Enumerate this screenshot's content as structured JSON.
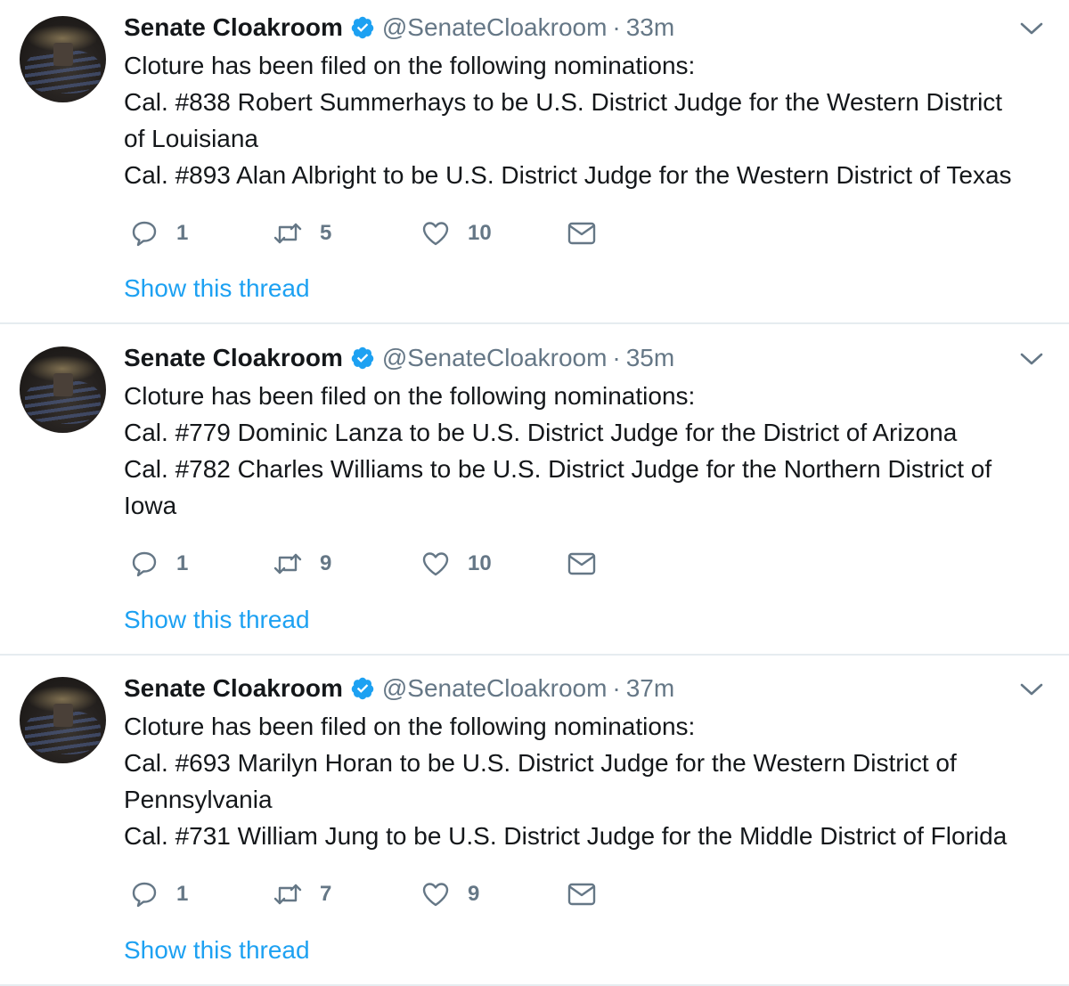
{
  "tweets": [
    {
      "name": "Senate Cloakroom",
      "handle": "@SenateCloakroom",
      "separator": "·",
      "time": "33m",
      "lines": [
        "Cloture has been filed on the following nominations:",
        "Cal. #838 Robert Summerhays to be U.S. District Judge for the Western District",
        "of Louisiana",
        "Cal. #893 Alan Albright to be U.S. District Judge for the Western District of Texas"
      ],
      "replies": "1",
      "retweets": "5",
      "likes": "10",
      "thread_link": "Show this thread"
    },
    {
      "name": "Senate Cloakroom",
      "handle": "@SenateCloakroom",
      "separator": "·",
      "time": "35m",
      "lines": [
        "Cloture has been filed on the following nominations:",
        "Cal. #779 Dominic Lanza to be U.S. District Judge for the District of Arizona",
        "Cal. #782 Charles Williams to be U.S. District Judge for the Northern District of",
        "Iowa"
      ],
      "replies": "1",
      "retweets": "9",
      "likes": "10",
      "thread_link": "Show this thread"
    },
    {
      "name": "Senate Cloakroom",
      "handle": "@SenateCloakroom",
      "separator": "·",
      "time": "37m",
      "lines": [
        "Cloture has been filed on the following nominations:",
        "Cal. #693 Marilyn Horan to be U.S. District Judge for the Western District of",
        "Pennsylvania",
        "Cal. #731 William Jung to be U.S. District Judge for the Middle District of Florida"
      ],
      "replies": "1",
      "retweets": "7",
      "likes": "9",
      "thread_link": "Show this thread"
    }
  ],
  "icons": {
    "verified": "verified-badge-icon",
    "menu": "chevron-down-icon",
    "reply": "reply-icon",
    "retweet": "retweet-icon",
    "like": "heart-icon",
    "message": "envelope-icon"
  },
  "colors": {
    "link": "#1da1f2",
    "verified": "#1da1f2",
    "muted": "#657786",
    "text": "#14171a",
    "divider": "#e6ecf0"
  }
}
